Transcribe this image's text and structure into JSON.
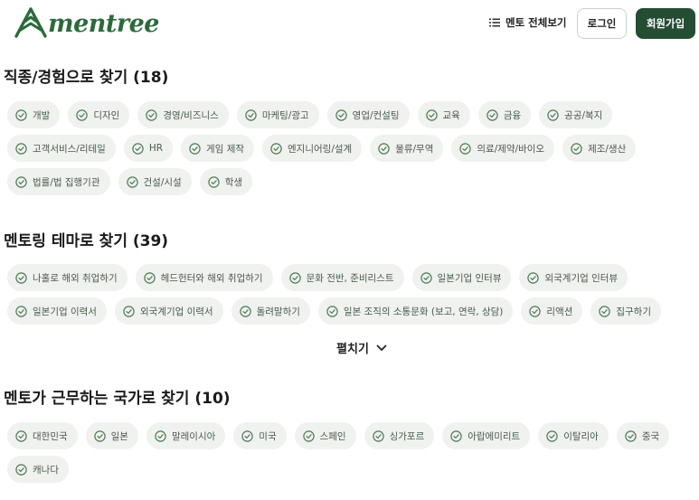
{
  "header": {
    "logo_text": "mentree",
    "nav_all_label": "멘토 전체보기",
    "login_label": "로그인",
    "signup_label": "회원가입"
  },
  "colors": {
    "brand_green": "#2c6a3c",
    "signup_bg": "#244d33",
    "chip_bg": "#f0f2ef"
  },
  "sections": {
    "job": {
      "title": "직종/경험으로 찾기 (18)",
      "rows": [
        [
          "개발",
          "디자인",
          "경영/비즈니스",
          "마케팅/광고",
          "영업/컨설팅",
          "교육",
          "금융",
          "공공/복지"
        ],
        [
          "고객서비스/리테일",
          "HR",
          "게임 제작",
          "엔지니어링/설계",
          "물류/무역",
          "의료/제약/바이오",
          "제조/생산"
        ],
        [
          "법률/법 집행기관",
          "건설/시설",
          "학생"
        ]
      ]
    },
    "theme": {
      "title": "멘토링 테마로 찾기 (39)",
      "rows": [
        [
          "나홀로 해외 취업하기",
          "헤드헌터와 해외 취업하기",
          "문화 전반, 준비리스트",
          "일본기업 인터뷰",
          "외국계기업 인터뷰"
        ],
        [
          "일본기업 이력서",
          "외국계기업 이력서",
          "돌려말하기",
          "일본 조직의 소통문화 (보고, 연락, 상담)",
          "리액션",
          "집구하기"
        ]
      ],
      "expand_label": "펼치기"
    },
    "country": {
      "title": "멘토가 근무하는 국가로 찾기 (10)",
      "rows": [
        [
          "대한민국",
          "일본",
          "말레이시아",
          "미국",
          "스페인",
          "싱가포르",
          "아랍에미리트",
          "이탈리아",
          "중국"
        ],
        [
          "캐나다"
        ]
      ]
    }
  }
}
